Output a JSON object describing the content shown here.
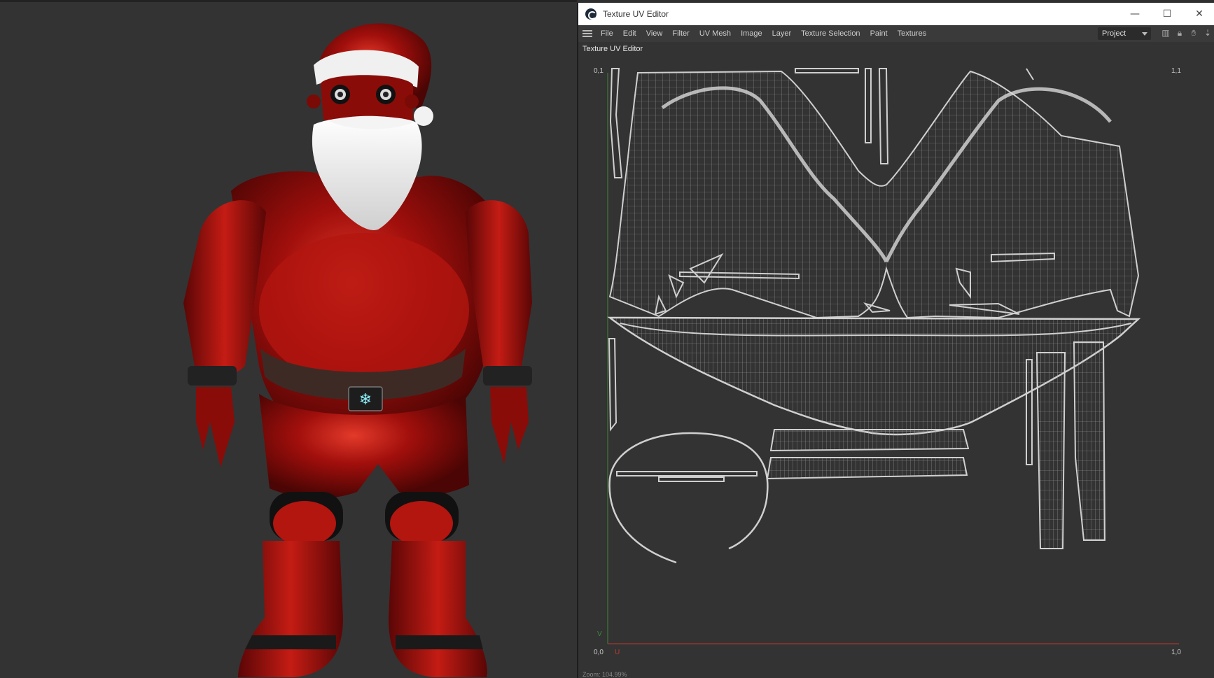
{
  "window": {
    "title": "Texture UV Editor",
    "minimize_glyph": "—",
    "maximize_glyph": "☐",
    "close_glyph": "✕"
  },
  "menu": {
    "items": [
      "File",
      "Edit",
      "View",
      "Filter",
      "UV Mesh",
      "Image",
      "Layer",
      "Texture Selection",
      "Paint",
      "Textures"
    ]
  },
  "toolbar": {
    "project_select": "Project",
    "icons": [
      "histogram-icon",
      "lock-icon",
      "hand-icon",
      "arrow-down-icon"
    ]
  },
  "panel": {
    "title": "Texture UV Editor"
  },
  "uv": {
    "top_left": "0,1",
    "top_right": "1,1",
    "bottom_left": "0,0",
    "bottom_right": "1,0",
    "axis_v": "V",
    "axis_u": "U",
    "axis_u_color": "#c0392b",
    "axis_v_color": "#3a8a3a",
    "wire_color": "#c8c8c8"
  },
  "viewport": {
    "background": "#333333",
    "model": "robot-santa"
  },
  "status": {
    "text": "Zoom: 104.99%"
  }
}
